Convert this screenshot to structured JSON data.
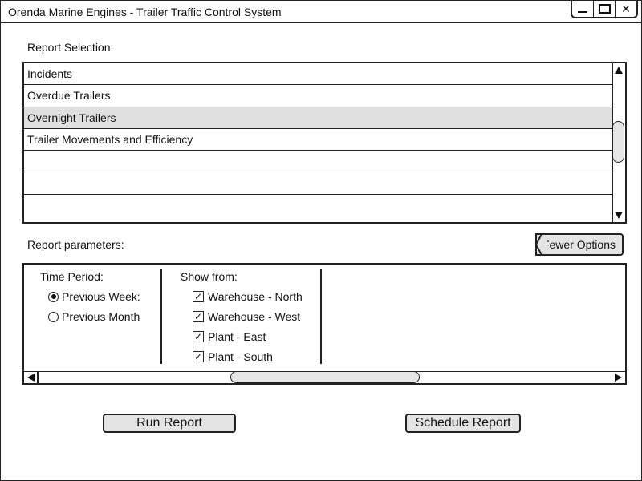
{
  "window": {
    "title": "Orenda Marine Engines - Trailer Traffic Control System",
    "controls": {
      "close_glyph": "✕"
    }
  },
  "report_selection": {
    "label": "Report Selection:",
    "items": [
      {
        "label": "Incidents",
        "selected": false
      },
      {
        "label": "Overdue Trailers",
        "selected": false
      },
      {
        "label": "Overnight Trailers",
        "selected": true
      },
      {
        "label": "Trailer Movements and Efficiency",
        "selected": false
      },
      {
        "label": "",
        "selected": false
      },
      {
        "label": "",
        "selected": false
      },
      {
        "label": "",
        "selected": false
      }
    ]
  },
  "report_parameters": {
    "label": "Report parameters:",
    "fewer_options_label": "Fewer Options",
    "time_period": {
      "label": "Time Period:",
      "options": [
        {
          "label": "Previous Week:",
          "selected": true
        },
        {
          "label": "Previous Month",
          "selected": false
        }
      ]
    },
    "show_from": {
      "label": "Show from:",
      "options": [
        {
          "label": "Warehouse - North",
          "checked": true
        },
        {
          "label": "Warehouse - West",
          "checked": true
        },
        {
          "label": "Plant - East",
          "checked": true
        },
        {
          "label": "Plant - South",
          "checked": true
        }
      ],
      "check_glyph": "✓"
    }
  },
  "actions": {
    "run_label": "Run Report",
    "schedule_label": "Schedule Report"
  }
}
